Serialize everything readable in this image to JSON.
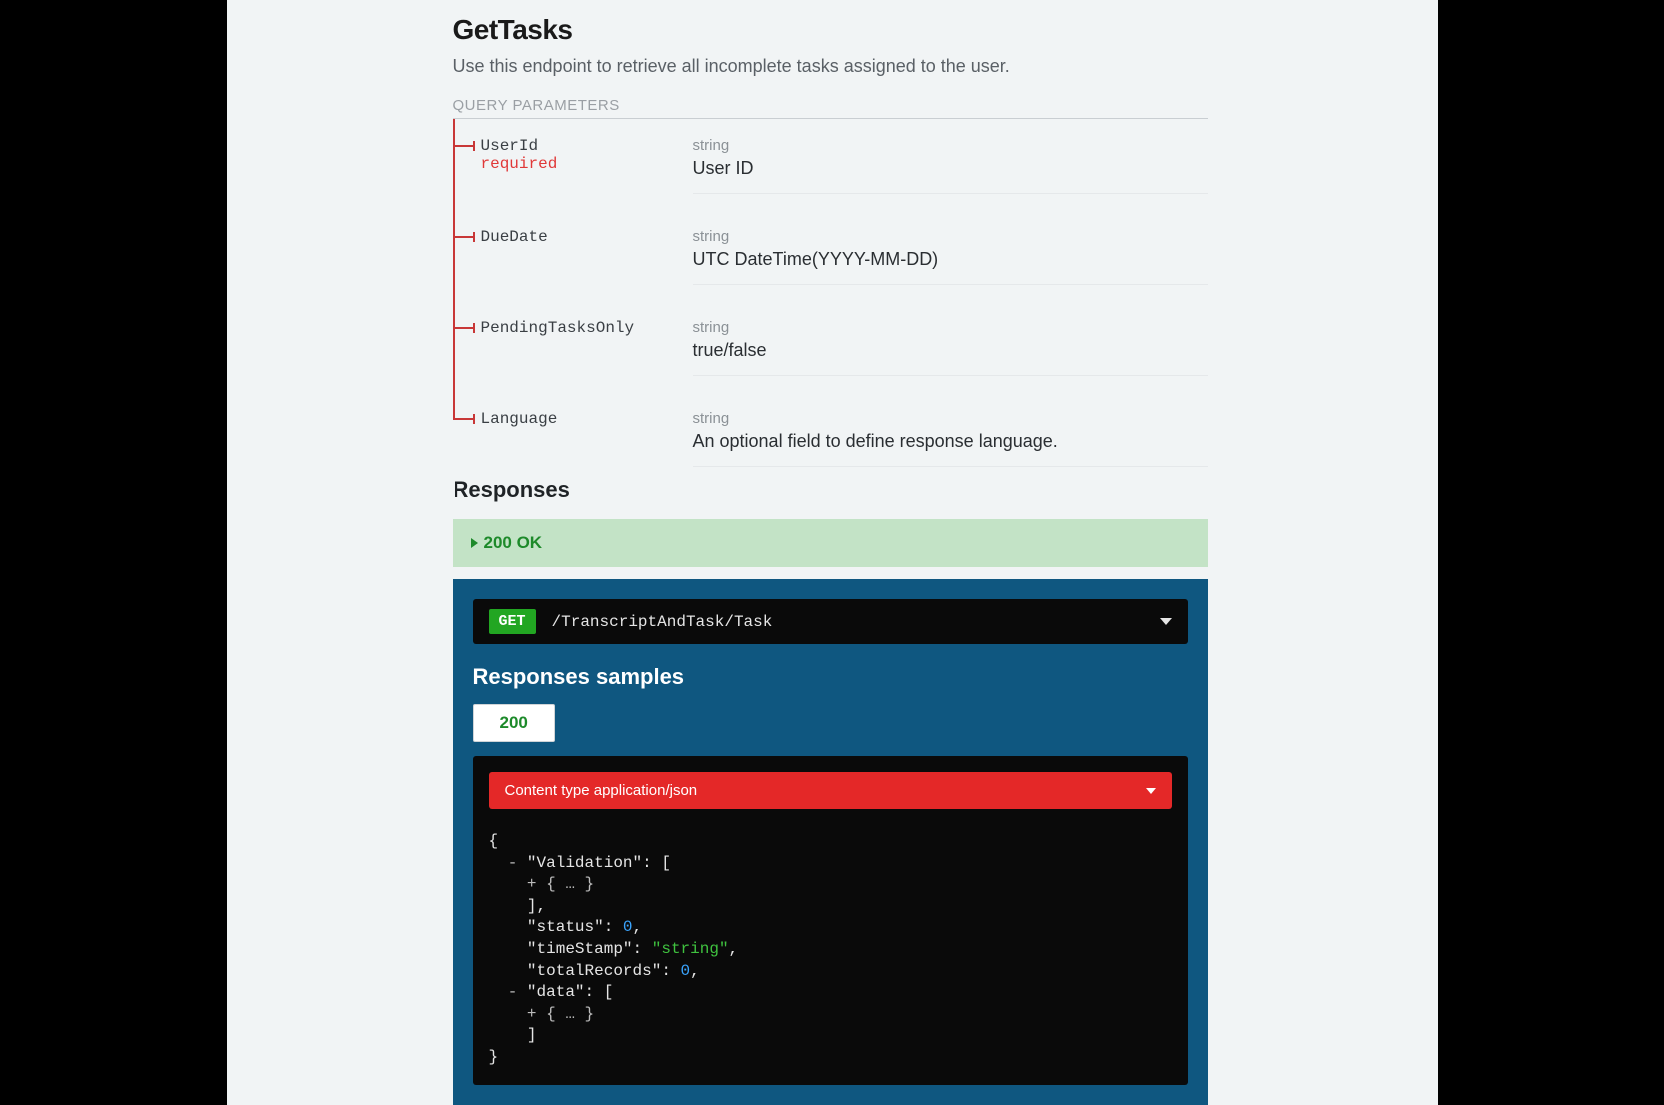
{
  "header": {
    "title": "GetTasks",
    "description": "Use this endpoint to retrieve all incomplete tasks assigned to the user."
  },
  "paramsSection": {
    "label": "QUERY PARAMETERS",
    "items": [
      {
        "name": "UserId",
        "required": "required",
        "type": "string",
        "desc": "User ID"
      },
      {
        "name": "DueDate",
        "required": "",
        "type": "string",
        "desc": "UTC DateTime(YYYY-MM-DD)"
      },
      {
        "name": "PendingTasksOnly",
        "required": "",
        "type": "string",
        "desc": "true/false"
      },
      {
        "name": "Language",
        "required": "",
        "type": "string",
        "desc": "An optional field to define response language."
      }
    ]
  },
  "responses": {
    "heading": "Responses",
    "status": "200 OK"
  },
  "endpoint": {
    "method": "GET",
    "path": "/TranscriptAndTask/Task"
  },
  "samples": {
    "heading": "Responses samples",
    "tab": "200",
    "contentTypeLabel": "Content type application/json"
  },
  "json": {
    "l1": "{",
    "l2a": "  - ",
    "l2b": "\"Validation\"",
    "l2c": ": [",
    "l3a": "    + ",
    "l3b": "{ … }",
    "l4": "    ],",
    "l5a": "    ",
    "l5b": "\"status\"",
    "l5c": ": ",
    "l5d": "0",
    "l5e": ",",
    "l6a": "    ",
    "l6b": "\"timeStamp\"",
    "l6c": ": ",
    "l6d": "\"string\"",
    "l6e": ",",
    "l7a": "    ",
    "l7b": "\"totalRecords\"",
    "l7c": ": ",
    "l7d": "0",
    "l7e": ",",
    "l8a": "  - ",
    "l8b": "\"data\"",
    "l8c": ": [",
    "l9a": "    + ",
    "l9b": "{ … }",
    "l10": "    ]",
    "l11": "}"
  }
}
